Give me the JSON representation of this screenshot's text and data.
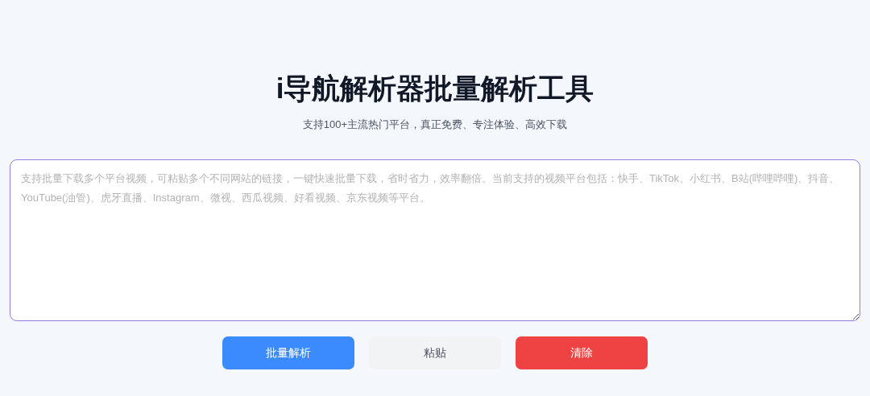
{
  "header": {
    "title": "i导航解析器批量解析工具",
    "subtitle": "支持100+主流热门平台，真正免费、专注体验、高效下载"
  },
  "input": {
    "placeholder": "支持批量下载多个平台视频，可粘贴多个不同网站的链接，一键快速批量下载，省时省力，效率翻倍。当前支持的视频平台包括：快手、TikTok、小红书、B站(哔哩哔哩)、抖音、YouTube(油管)、虎牙直播、Instagram、微视、西瓜视频、好看视频、京东视频等平台。"
  },
  "buttons": [
    {
      "label": "批量解析",
      "kind": "primary"
    },
    {
      "label": "粘贴",
      "kind": "neutral"
    },
    {
      "label": "清除",
      "kind": "danger"
    }
  ]
}
